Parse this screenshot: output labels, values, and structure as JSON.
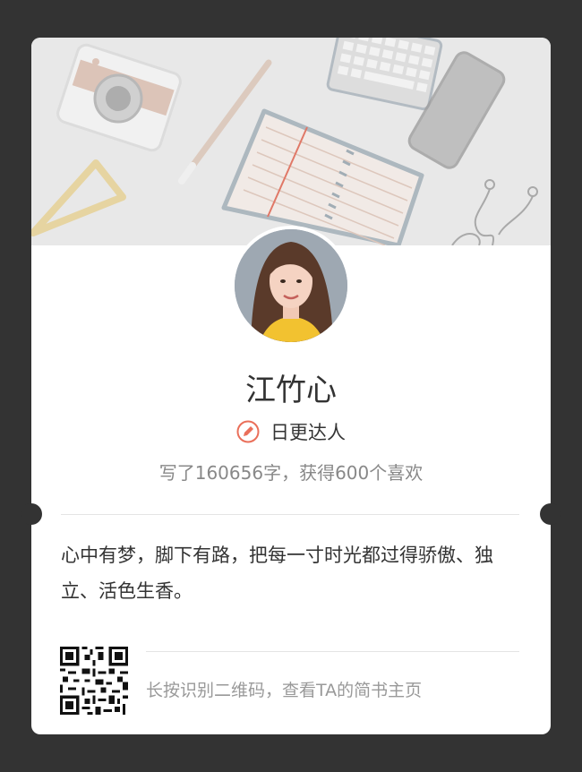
{
  "profile": {
    "name": "江竹心",
    "badge_label": "日更达人",
    "stats_text": "写了160656字，获得600个喜欢",
    "bio": "心中有梦，脚下有路，把每一寸时光都过得骄傲、独立、活色生香。"
  },
  "footer": {
    "qr_hint": "长按识别二维码，查看TA的简书主页"
  },
  "colors": {
    "page_background": "#333333",
    "card_background": "#ffffff",
    "banner_background": "#e8e8e8",
    "badge_accent": "#ea6f5a"
  },
  "icons": {
    "badge": "pencil-badge-icon",
    "qr": "qr-code-icon"
  }
}
